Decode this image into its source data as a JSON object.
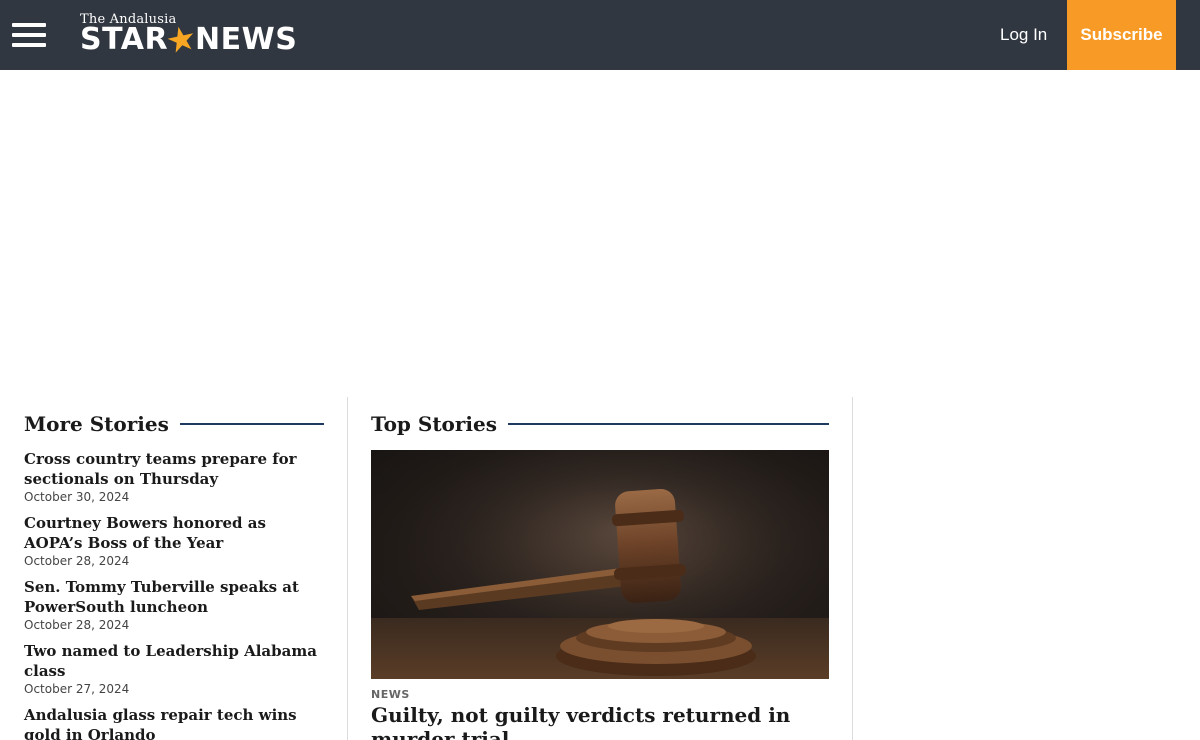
{
  "header": {
    "logo_top": "The Andalusia",
    "logo_left": "STAR",
    "logo_right": "NEWS",
    "login_label": "Log In",
    "subscribe_label": "Subscribe",
    "bg_color": "#313740",
    "accent_color": "#f89a26"
  },
  "more_stories": {
    "title": "More Stories",
    "items": [
      {
        "title": "Cross country teams prepare for sectionals on Thursday",
        "date": "October 30, 2024"
      },
      {
        "title": "Courtney Bowers honored as AOPA’s Boss of the Year",
        "date": "October 28, 2024"
      },
      {
        "title": "Sen. Tommy Tuberville speaks at PowerSouth luncheon",
        "date": "October 28, 2024"
      },
      {
        "title": "Two named to Leadership Alabama class",
        "date": "October 27, 2024"
      },
      {
        "title": "Andalusia glass repair tech wins gold in Orlando",
        "date": ""
      }
    ]
  },
  "top_stories": {
    "title": "Top Stories",
    "feature": {
      "image_icon": "gavel-image",
      "category": "NEWS",
      "title": "Guilty, not guilty verdicts returned in murder trial"
    }
  }
}
